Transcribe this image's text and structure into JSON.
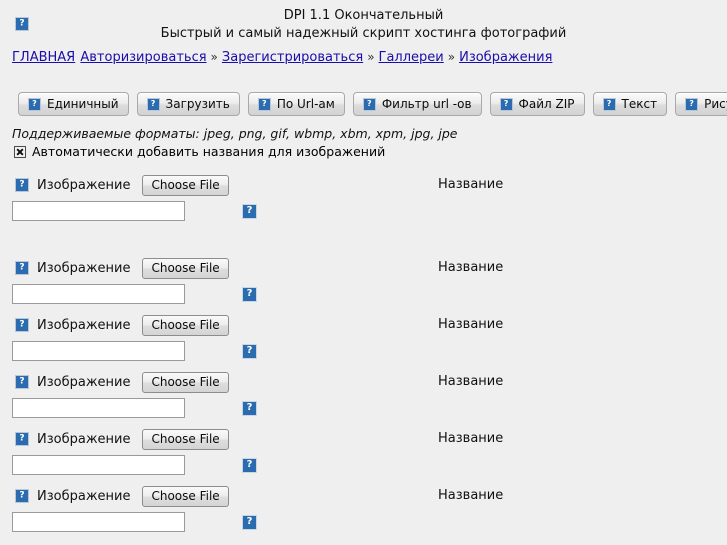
{
  "header": {
    "broken_image_icon": "broken-image-icon",
    "title": "DPI 1.1 Окончательный",
    "subtitle": "Быстрый и самый надежный скрипт хостинга фотографий"
  },
  "breadcrumb": {
    "separator": "»",
    "items": [
      {
        "label": "ГЛАВНАЯ"
      },
      {
        "label": "Авторизироваться"
      },
      {
        "label": "Зарегистрироваться"
      },
      {
        "label": "Галлереи"
      },
      {
        "label": "Изображения"
      }
    ]
  },
  "toolbar": {
    "buttons": [
      {
        "label": "Единичный"
      },
      {
        "label": "Загрузить"
      },
      {
        "label": "По Url-ам"
      },
      {
        "label": "Фильтр url -ов"
      },
      {
        "label": "Файл ZIP"
      },
      {
        "label": "Текст"
      },
      {
        "label": "Рисунок"
      }
    ]
  },
  "formats_note": "Поддерживаемые форматы: jpeg, png, gif, wbmp, xbm, xpm, jpg, jpe",
  "auto_titles": {
    "checked": true,
    "label": "Автоматически добавить названия для изображений"
  },
  "upload_rows": {
    "image_label": "Изображение",
    "choose_file_label": "Choose File",
    "title_label": "Название",
    "input_value": "",
    "input_placeholder": "",
    "rows": [
      {
        "index": 1
      },
      {
        "index": 2
      },
      {
        "index": 3
      },
      {
        "index": 4
      },
      {
        "index": 5
      },
      {
        "index": 6
      }
    ]
  },
  "colors": {
    "page_background": "#efefef",
    "link": "#1a0dab",
    "icon_blue": "#2b6cb0",
    "text": "#111111",
    "input_background": "#ffffff",
    "button_border": "#a9a9a9"
  }
}
